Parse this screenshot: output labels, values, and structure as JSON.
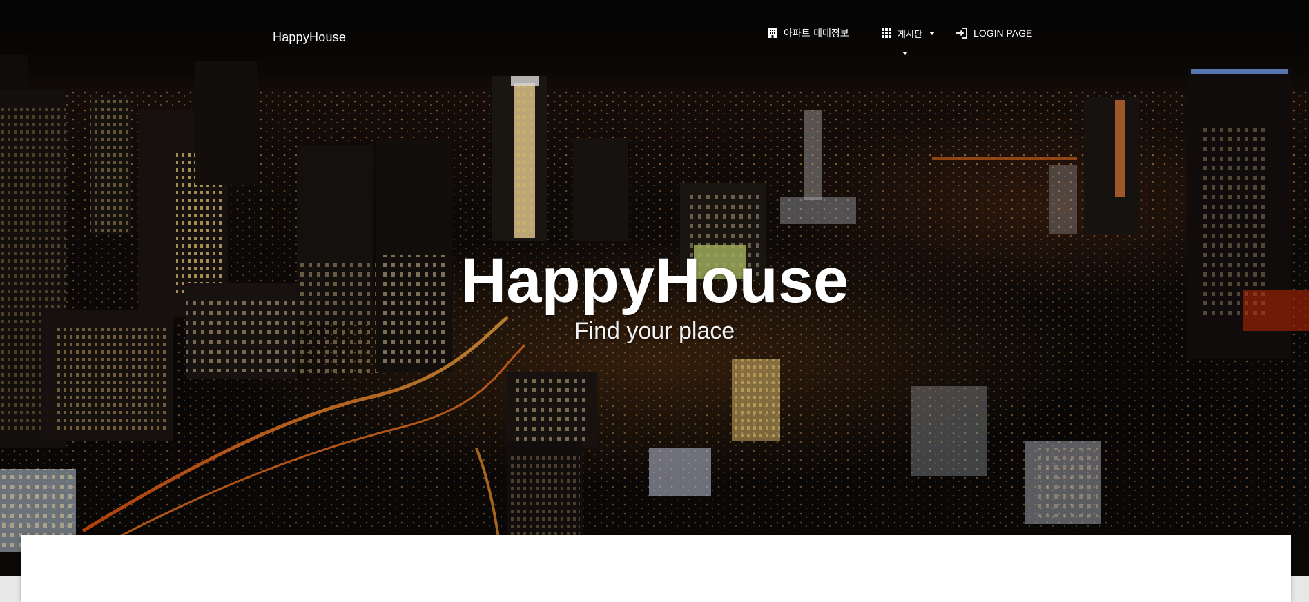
{
  "navbar": {
    "brand": "HappyHouse",
    "items": [
      {
        "label": "아파트 매매정보",
        "icon": "building-icon"
      },
      {
        "label": "게시판",
        "icon": "grid-icon",
        "has_dropdown": true
      },
      {
        "label": "LOGIN PAGE",
        "icon": "login-icon"
      }
    ]
  },
  "hero": {
    "title": "HappyHouse",
    "subtitle": "Find your place"
  },
  "colors": {
    "nav_text": "#ffffff",
    "hero_text": "#ffffff",
    "card_background": "#ffffff",
    "page_background": "#e8e8e8"
  }
}
